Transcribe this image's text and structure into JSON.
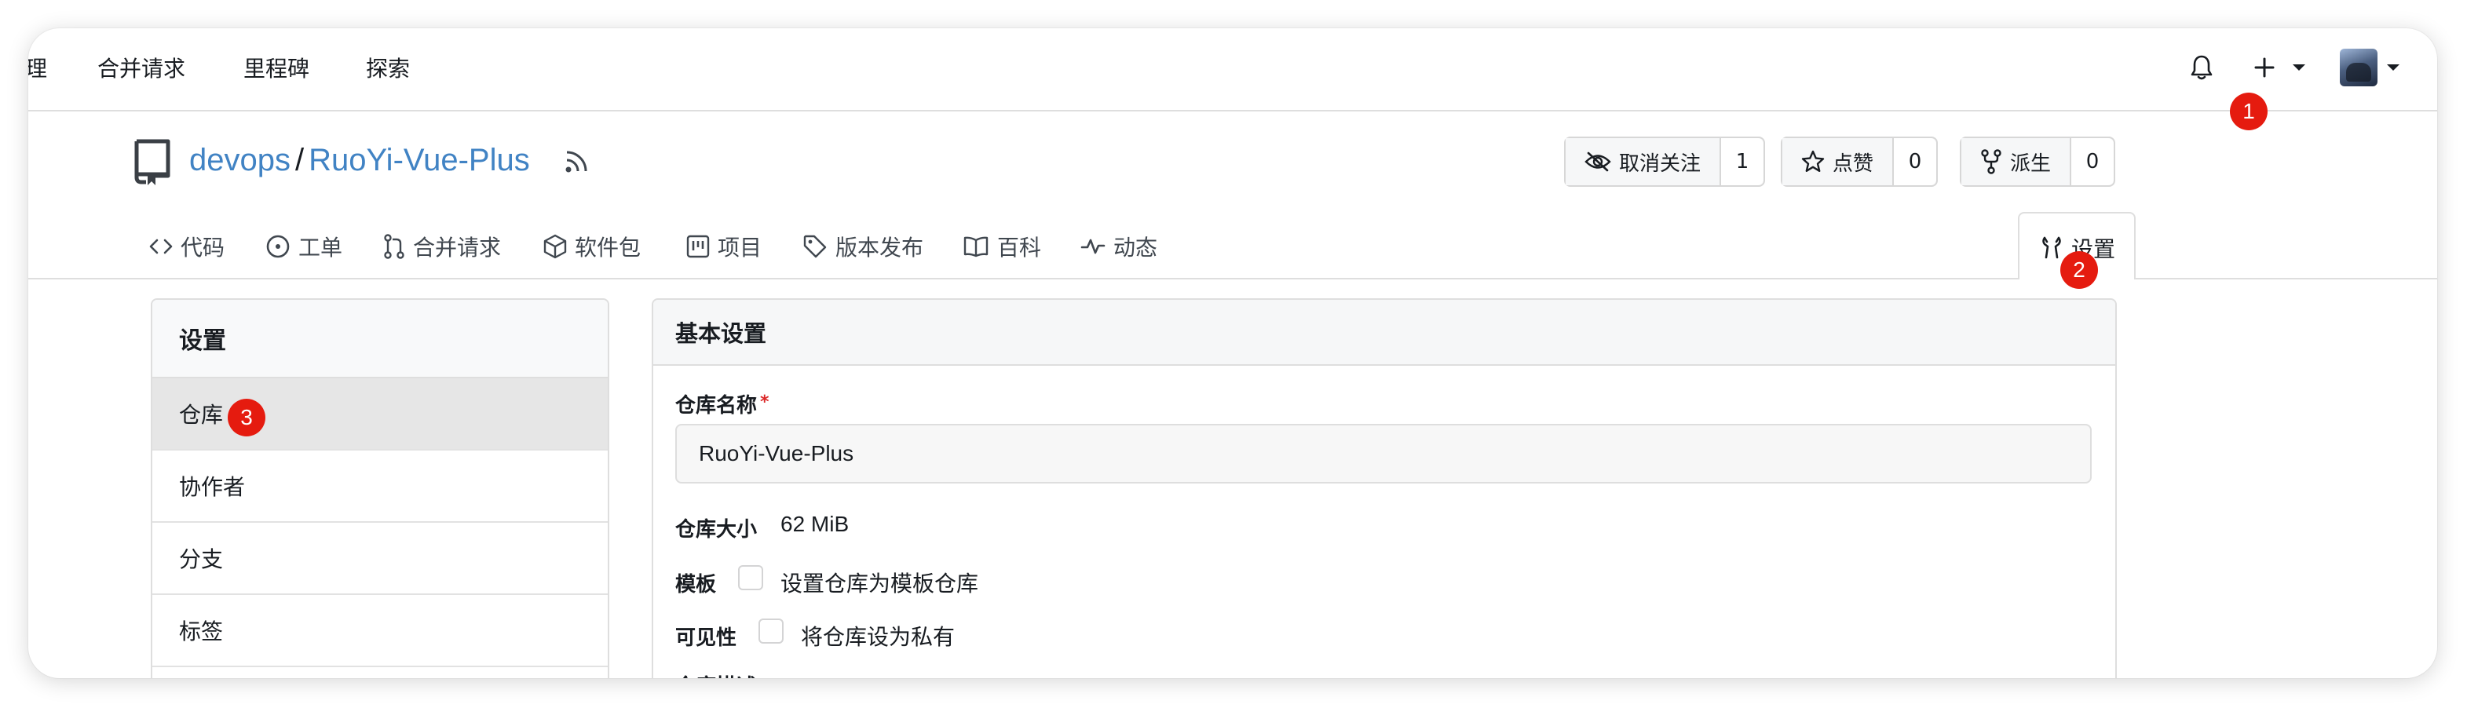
{
  "topnav": {
    "partial_left": "理",
    "links": [
      "合并请求",
      "里程碑",
      "探索"
    ]
  },
  "repo": {
    "owner": "devops",
    "separator": "/",
    "name": "RuoYi-Vue-Plus",
    "buttons": {
      "watch": {
        "label": "取消关注",
        "count": "1"
      },
      "star": {
        "label": "点赞",
        "count": "0"
      },
      "fork": {
        "label": "派生",
        "count": "0"
      }
    }
  },
  "tabs": [
    {
      "label": "代码",
      "icon": "code-icon"
    },
    {
      "label": "工单",
      "icon": "issue-icon"
    },
    {
      "label": "合并请求",
      "icon": "pull-request-icon"
    },
    {
      "label": "软件包",
      "icon": "package-icon"
    },
    {
      "label": "项目",
      "icon": "project-icon"
    },
    {
      "label": "版本发布",
      "icon": "tag-icon"
    },
    {
      "label": "百科",
      "icon": "book-icon"
    },
    {
      "label": "动态",
      "icon": "pulse-icon"
    }
  ],
  "active_tab": {
    "label": "设置",
    "icon": "tools-icon"
  },
  "annotations": [
    "1",
    "2",
    "3"
  ],
  "sidebar": {
    "title": "设置",
    "items": [
      {
        "label": "仓库"
      },
      {
        "label": "协作者"
      },
      {
        "label": "分支"
      },
      {
        "label": "标签"
      }
    ]
  },
  "panel": {
    "title": "基本设置",
    "repo_name_label": "仓库名称",
    "required_mark": "*",
    "repo_name_value": "RuoYi-Vue-Plus",
    "size_label": "仓库大小",
    "size_value": "62 MiB",
    "template_label": "模板",
    "template_checkbox_label": "设置仓库为模板仓库",
    "visibility_label": "可见性",
    "visibility_checkbox_label": "将仓库设为私有",
    "description_label_partial": "仓库描述"
  },
  "colors": {
    "link": "#4183c4",
    "badge": "#e51b0f",
    "border": "#dedede"
  }
}
